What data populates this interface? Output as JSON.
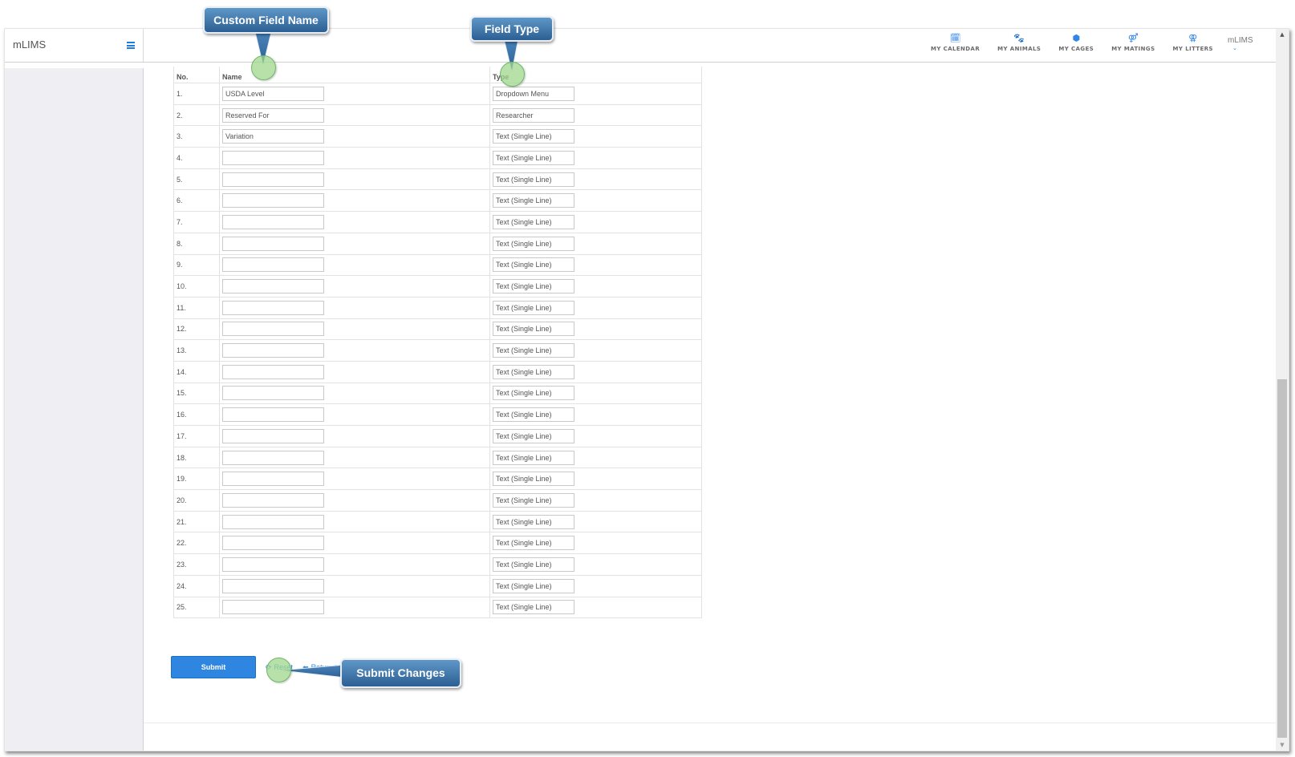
{
  "app": {
    "brand": "mLIMS",
    "menu_icon": "hamburger-icon"
  },
  "nav": {
    "items": [
      {
        "label": "MY CALENDAR",
        "icon": "calendar-icon",
        "glyph": "🗓"
      },
      {
        "label": "MY ANIMALS",
        "icon": "paw-icon",
        "glyph": "🐾"
      },
      {
        "label": "MY CAGES",
        "icon": "cube-icon",
        "glyph": "⬢"
      },
      {
        "label": "MY MATINGS",
        "icon": "mating-symbol-icon",
        "glyph": "⚤"
      },
      {
        "label": "MY LITTERS",
        "icon": "litter-symbol-icon",
        "glyph": "⚢"
      }
    ],
    "user": {
      "name": "mLIMS",
      "chevron": "⌄"
    }
  },
  "table": {
    "headers": {
      "no": "No.",
      "name": "Name",
      "type": "Type"
    },
    "rows": [
      {
        "no": "1.",
        "name": "USDA Level",
        "type": "Dropdown Menu"
      },
      {
        "no": "2.",
        "name": "Reserved For",
        "type": "Researcher"
      },
      {
        "no": "3.",
        "name": "Variation",
        "type": "Text (Single Line)"
      },
      {
        "no": "4.",
        "name": "",
        "type": "Text (Single Line)"
      },
      {
        "no": "5.",
        "name": "",
        "type": "Text (Single Line)"
      },
      {
        "no": "6.",
        "name": "",
        "type": "Text (Single Line)"
      },
      {
        "no": "7.",
        "name": "",
        "type": "Text (Single Line)"
      },
      {
        "no": "8.",
        "name": "",
        "type": "Text (Single Line)"
      },
      {
        "no": "9.",
        "name": "",
        "type": "Text (Single Line)"
      },
      {
        "no": "10.",
        "name": "",
        "type": "Text (Single Line)"
      },
      {
        "no": "11.",
        "name": "",
        "type": "Text (Single Line)"
      },
      {
        "no": "12.",
        "name": "",
        "type": "Text (Single Line)"
      },
      {
        "no": "13.",
        "name": "",
        "type": "Text (Single Line)"
      },
      {
        "no": "14.",
        "name": "",
        "type": "Text (Single Line)"
      },
      {
        "no": "15.",
        "name": "",
        "type": "Text (Single Line)"
      },
      {
        "no": "16.",
        "name": "",
        "type": "Text (Single Line)"
      },
      {
        "no": "17.",
        "name": "",
        "type": "Text (Single Line)"
      },
      {
        "no": "18.",
        "name": "",
        "type": "Text (Single Line)"
      },
      {
        "no": "19.",
        "name": "",
        "type": "Text (Single Line)"
      },
      {
        "no": "20.",
        "name": "",
        "type": "Text (Single Line)"
      },
      {
        "no": "21.",
        "name": "",
        "type": "Text (Single Line)"
      },
      {
        "no": "22.",
        "name": "",
        "type": "Text (Single Line)"
      },
      {
        "no": "23.",
        "name": "",
        "type": "Text (Single Line)"
      },
      {
        "no": "24.",
        "name": "",
        "type": "Text (Single Line)"
      },
      {
        "no": "25.",
        "name": "",
        "type": "Text (Single Line)"
      }
    ]
  },
  "actions": {
    "submit_label": "Submit",
    "reset_label": "Reset",
    "reset_icon": "refresh-icon",
    "return_label": "Return to System Settings",
    "return_icon": "back-arrow-icon"
  },
  "annotations": {
    "custom_field_name": "Custom Field Name",
    "field_type": "Field Type",
    "submit_changes": "Submit Changes"
  },
  "colors": {
    "accent": "#2f86e0",
    "sidebar_bg": "#efeef3",
    "callout_top": "#5f97c8",
    "callout_bottom": "#2c5f93",
    "hotspot": "#a0d78c"
  }
}
